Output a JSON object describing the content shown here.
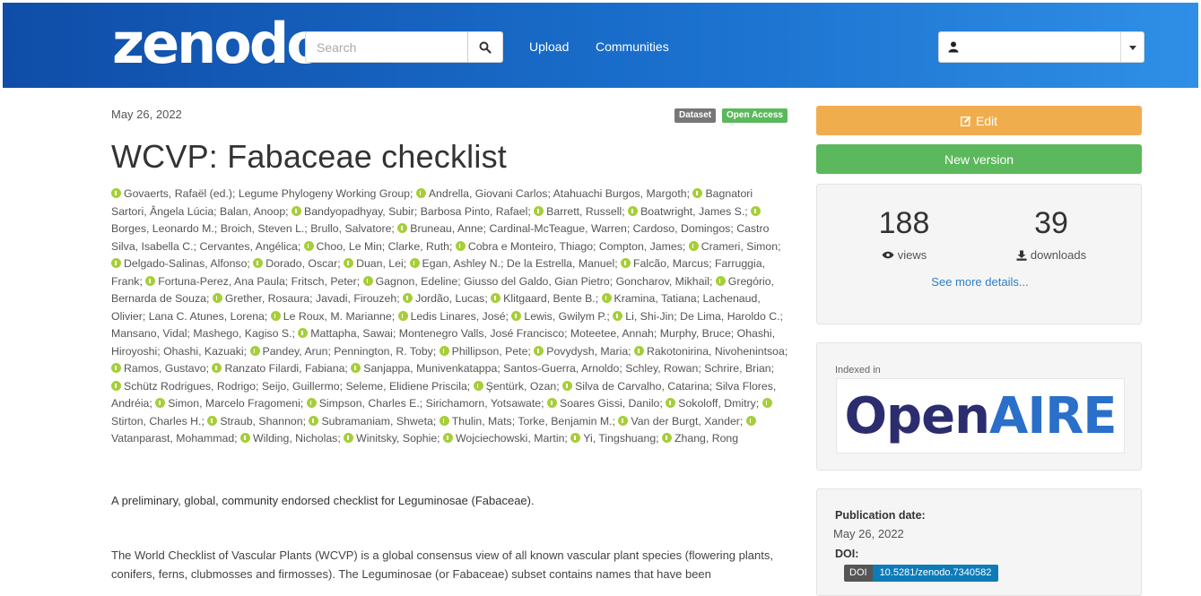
{
  "header": {
    "logo": "zenodo",
    "search_placeholder": "Search",
    "nav": [
      "Upload",
      "Communities"
    ],
    "user_value": ""
  },
  "record": {
    "date": "May 26, 2022",
    "badges": [
      "Dataset",
      "Open Access"
    ],
    "title": "WCVP: Fabaceae checklist",
    "authors": [
      {
        "name": "Govaerts, Rafaël (ed.)",
        "orcid": true
      },
      {
        "name": "Legume Phylogeny Working Group",
        "orcid": false
      },
      {
        "name": "Andrella, Giovani Carlos",
        "orcid": true
      },
      {
        "name": "Atahuachi Burgos, Margoth",
        "orcid": false
      },
      {
        "name": "Bagnatori Sartori, Ângela Lúcia",
        "orcid": true
      },
      {
        "name": "Balan, Anoop",
        "orcid": false
      },
      {
        "name": "Bandyopadhyay, Subir",
        "orcid": true
      },
      {
        "name": "Barbosa Pinto, Rafael",
        "orcid": false
      },
      {
        "name": "Barrett, Russell",
        "orcid": true
      },
      {
        "name": "Boatwright, James S.",
        "orcid": true
      },
      {
        "name": "Borges, Leonardo M.",
        "orcid": true
      },
      {
        "name": "Broich, Steven L.",
        "orcid": false
      },
      {
        "name": "Brullo, Salvatore",
        "orcid": false
      },
      {
        "name": "Bruneau, Anne",
        "orcid": true
      },
      {
        "name": "Cardinal-McTeague, Warren",
        "orcid": false
      },
      {
        "name": "Cardoso, Domingos",
        "orcid": false
      },
      {
        "name": "Castro Silva, Isabella C.",
        "orcid": false
      },
      {
        "name": "Cervantes, Angélica",
        "orcid": false
      },
      {
        "name": "Choo, Le Min",
        "orcid": true
      },
      {
        "name": "Clarke, Ruth",
        "orcid": false
      },
      {
        "name": "Cobra e Monteiro, Thiago",
        "orcid": true
      },
      {
        "name": "Compton, James",
        "orcid": false
      },
      {
        "name": "Crameri, Simon",
        "orcid": true
      },
      {
        "name": "Delgado-Salinas, Alfonso",
        "orcid": true
      },
      {
        "name": "Dorado, Oscar",
        "orcid": true
      },
      {
        "name": "Duan, Lei",
        "orcid": true
      },
      {
        "name": "Egan, Ashley N.",
        "orcid": true
      },
      {
        "name": "De la Estrella, Manuel",
        "orcid": false
      },
      {
        "name": "Falcão, Marcus",
        "orcid": true
      },
      {
        "name": "Farruggia, Frank",
        "orcid": false
      },
      {
        "name": "Fortuna-Perez, Ana Paula",
        "orcid": true
      },
      {
        "name": "Fritsch, Peter",
        "orcid": false
      },
      {
        "name": "Gagnon, Edeline",
        "orcid": true
      },
      {
        "name": "Giusso del Galdo, Gian Pietro",
        "orcid": false
      },
      {
        "name": "Goncharov, Mikhail",
        "orcid": false
      },
      {
        "name": "Gregório, Bernarda de Souza",
        "orcid": true
      },
      {
        "name": "Grether, Rosaura",
        "orcid": true
      },
      {
        "name": "Javadi, Firouzeh",
        "orcid": false
      },
      {
        "name": "Jordão, Lucas",
        "orcid": true
      },
      {
        "name": "Klitgaard, Bente B.",
        "orcid": true
      },
      {
        "name": "Kramina, Tatiana",
        "orcid": true
      },
      {
        "name": "Lachenaud, Olivier",
        "orcid": false
      },
      {
        "name": "Lana C. Atunes, Lorena",
        "orcid": false
      },
      {
        "name": "Le Roux, M. Marianne",
        "orcid": true
      },
      {
        "name": "Ledis Linares, José",
        "orcid": true
      },
      {
        "name": "Lewis, Gwilym P.",
        "orcid": true
      },
      {
        "name": "Li, Shi-Jin",
        "orcid": true
      },
      {
        "name": "De Lima, Haroldo C.",
        "orcid": false
      },
      {
        "name": "Mansano, Vidal",
        "orcid": false
      },
      {
        "name": "Mashego, Kagiso S.",
        "orcid": false
      },
      {
        "name": "Mattapha, Sawai",
        "orcid": true
      },
      {
        "name": "Montenegro Valls, José Francisco",
        "orcid": false
      },
      {
        "name": "Moteetee, Annah",
        "orcid": false
      },
      {
        "name": "Murphy, Bruce",
        "orcid": false
      },
      {
        "name": "Ohashi, Hiroyoshi",
        "orcid": false
      },
      {
        "name": "Ohashi, Kazuaki",
        "orcid": false
      },
      {
        "name": "Pandey, Arun",
        "orcid": true
      },
      {
        "name": "Pennington, R. Toby",
        "orcid": false
      },
      {
        "name": "Phillipson, Pete",
        "orcid": true
      },
      {
        "name": "Povydysh, Maria",
        "orcid": true
      },
      {
        "name": "Rakotonirina, Nivohenintsoa",
        "orcid": true
      },
      {
        "name": "Ramos, Gustavo",
        "orcid": true
      },
      {
        "name": "Ranzato Filardi, Fabiana",
        "orcid": true
      },
      {
        "name": "Sanjappa, Munivenkatappa",
        "orcid": true
      },
      {
        "name": "Santos-Guerra, Arnoldo",
        "orcid": false
      },
      {
        "name": "Schley, Rowan",
        "orcid": false
      },
      {
        "name": "Schrire, Brian",
        "orcid": false
      },
      {
        "name": "Schütz Rodrigues, Rodrigo",
        "orcid": true
      },
      {
        "name": "Seijo, Guillermo",
        "orcid": false
      },
      {
        "name": "Seleme, Elidiene Priscila",
        "orcid": false
      },
      {
        "name": "Şentürk, Ozan",
        "orcid": true
      },
      {
        "name": "Silva de Carvalho, Catarina",
        "orcid": true
      },
      {
        "name": "Silva Flores, Andréia",
        "orcid": false
      },
      {
        "name": "Simon, Marcelo Fragomeni",
        "orcid": true
      },
      {
        "name": "Simpson, Charles E.",
        "orcid": true
      },
      {
        "name": "Sirichamorn, Yotsawate",
        "orcid": false
      },
      {
        "name": "Soares Gissi, Danilo",
        "orcid": true
      },
      {
        "name": "Sokoloff, Dmitry",
        "orcid": true
      },
      {
        "name": "Stirton, Charles H.",
        "orcid": true
      },
      {
        "name": "Straub, Shannon",
        "orcid": true
      },
      {
        "name": "Subramaniam, Shweta",
        "orcid": true
      },
      {
        "name": "Thulin, Mats",
        "orcid": true
      },
      {
        "name": "Torke, Benjamin M.",
        "orcid": false
      },
      {
        "name": "Van der Burgt, Xander",
        "orcid": true
      },
      {
        "name": "Vatanparast, Mohammad",
        "orcid": true
      },
      {
        "name": "Wilding, Nicholas",
        "orcid": true
      },
      {
        "name": "Winitsky, Sophie",
        "orcid": true
      },
      {
        "name": "Wojciechowski, Martin",
        "orcid": true
      },
      {
        "name": "Yi, Tingshuang",
        "orcid": true
      },
      {
        "name": "Zhang, Rong",
        "orcid": true
      }
    ],
    "description": "A preliminary, global, community endorsed checklist for Leguminosae (Fabaceae).",
    "paragraph": "The World Checklist of Vascular Plants (WCVP) is a global consensus view of all known vascular plant species (flowering plants, conifers, ferns, clubmosses and firmosses). The Leguminosae (or Fabaceae) subset contains names that have been"
  },
  "sidebar": {
    "edit_label": "Edit",
    "new_version_label": "New version",
    "views_count": "188",
    "views_label": "views",
    "downloads_count": "39",
    "downloads_label": "downloads",
    "see_more": "See more details...",
    "indexed_in": "Indexed in",
    "openaire_logo": "OpenAIRE",
    "pub_date_label": "Publication date:",
    "pub_date_value": "May 26, 2022",
    "doi_label": "DOI:",
    "doi_key": "DOI",
    "doi_value": "10.5281/zenodo.7340582"
  },
  "colors": {
    "header_start": "#0f4da8",
    "header_end": "#2f8fe6",
    "edit_button": "#f0ad4e",
    "new_version_button": "#5cb85c",
    "orcid": "#a6ce39",
    "link": "#2a7fc9"
  }
}
